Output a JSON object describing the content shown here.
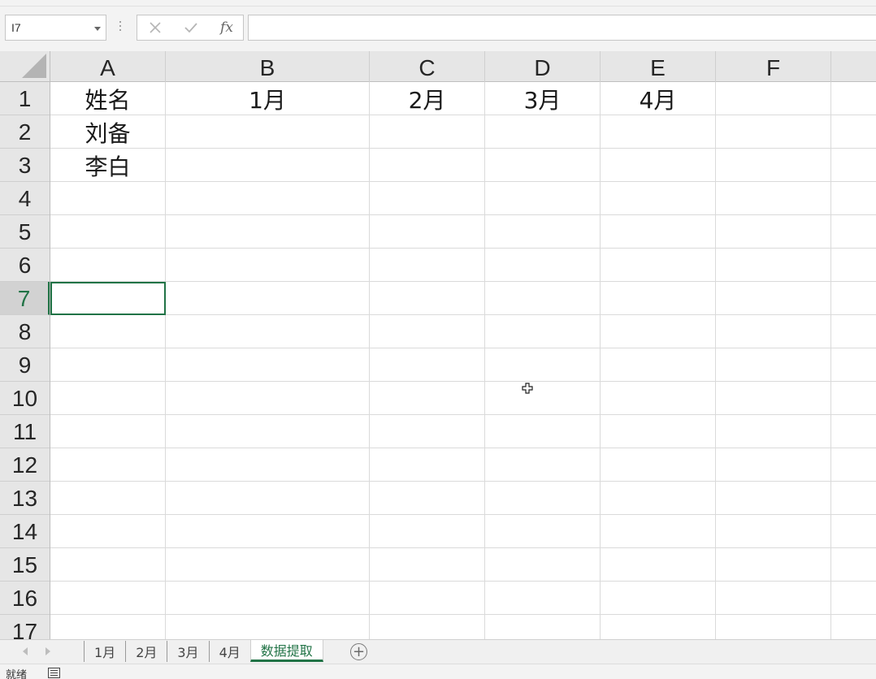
{
  "formula_bar": {
    "name_box": "I7",
    "fx_label": "fx",
    "formula": ""
  },
  "columns": [
    "A",
    "B",
    "C",
    "D",
    "E",
    "F"
  ],
  "rows": [
    "1",
    "2",
    "3",
    "4",
    "5",
    "6",
    "7",
    "8",
    "9",
    "10",
    "11",
    "12",
    "13",
    "14",
    "15",
    "16",
    "17"
  ],
  "cells": {
    "A1": "姓名",
    "B1": "1月",
    "C1": "2月",
    "D1": "3月",
    "E1": "4月",
    "A2": "刘备",
    "A3": "李白"
  },
  "sheet_tabs": [
    "1月",
    "2月",
    "3月",
    "4月",
    "数据提取"
  ],
  "active_sheet": "数据提取",
  "status": {
    "text": "就绪"
  },
  "colors": {
    "accent": "#217346",
    "header_bg": "#e6e6e6",
    "gridline": "#dadada"
  },
  "icons": {
    "cancel": "x-icon",
    "enter": "check-icon",
    "insert_function": "fx-icon",
    "add_sheet": "plus-circle-icon",
    "select_all": "select-all-triangle-icon",
    "cursor": "cell-cursor-icon"
  }
}
